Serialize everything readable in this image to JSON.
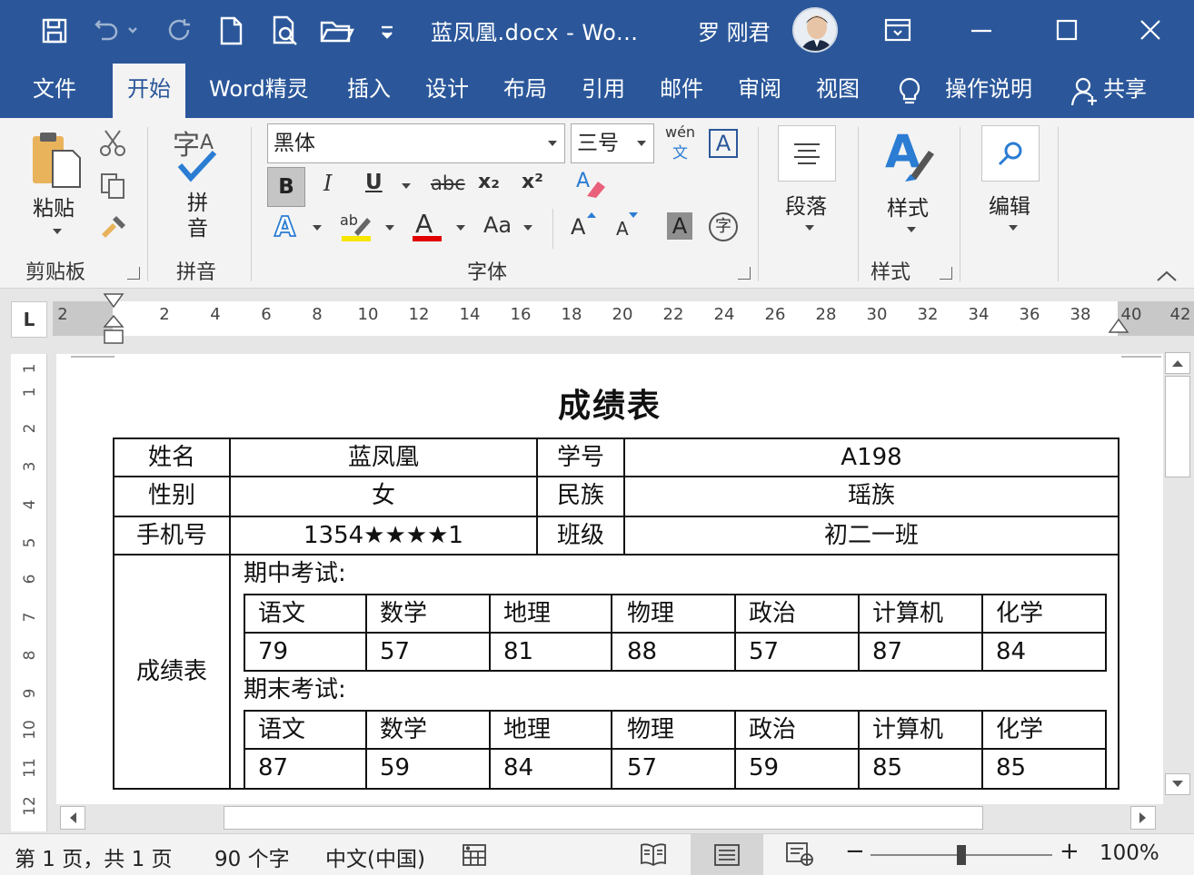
{
  "titlebar": {
    "doc_title": "蓝凤凰.docx  -  Wo...",
    "user_name": "罗 刚君",
    "icons": [
      "save-icon",
      "undo-icon",
      "redo-icon",
      "new-doc-icon",
      "print-preview-icon",
      "open-folder-icon",
      "customize-qat-icon"
    ]
  },
  "tabs": [
    "文件",
    "开始",
    "Word精灵",
    "插入",
    "设计",
    "布局",
    "引用",
    "邮件",
    "审阅",
    "视图"
  ],
  "tell_me": "操作说明",
  "share": "共享",
  "ribbon": {
    "paste": "粘贴",
    "clipboard_group": "剪贴板",
    "pinyin_btn": "拼\n音",
    "pinyin_group": "拼音",
    "font_name": "黑体",
    "font_size": "三号",
    "font_group": "字体",
    "bold": "B",
    "italic": "I",
    "underline": "U",
    "strike": "abc",
    "subscript": "x₂",
    "superscript": "x²",
    "change_case": "Aa",
    "grow_font": "A",
    "shrink_font": "A",
    "char_shading": "A",
    "enclose_char": "字",
    "wen": "wén",
    "wen_sub": "文",
    "char_border": "A",
    "paragraph": "段落",
    "styles": "样式",
    "styles_group": "样式",
    "editing": "编辑"
  },
  "ruler": {
    "corner": "L",
    "left_margin_label": "2",
    "numbers": [
      "2",
      "4",
      "6",
      "8",
      "10",
      "12",
      "14",
      "16",
      "18",
      "20",
      "22",
      "24",
      "26",
      "28",
      "30",
      "32",
      "34",
      "36",
      "38",
      "40",
      "42"
    ]
  },
  "vruler_numbers": [
    "1",
    "1",
    "2",
    "3",
    "4",
    "5",
    "6",
    "7",
    "8",
    "9",
    "10",
    "11",
    "12"
  ],
  "document": {
    "heading": "成绩表",
    "info": {
      "name_label": "姓名",
      "name_value": "蓝凤凰",
      "id_label": "学号",
      "id_value": "A198",
      "gender_label": "性别",
      "gender_value": "女",
      "ethnic_label": "民族",
      "ethnic_value": "瑶族",
      "phone_label": "手机号",
      "phone_value": "1354★★★★1",
      "class_label": "班级",
      "class_value": "初二一班"
    },
    "scores_label": "成绩表",
    "midterm": {
      "title": "期中考试:",
      "headers": [
        "语文",
        "数学",
        "地理",
        "物理",
        "政治",
        "计算机",
        "化学"
      ],
      "values": [
        "79",
        "57",
        "81",
        "88",
        "57",
        "87",
        "84"
      ]
    },
    "final": {
      "title": "期末考试:",
      "headers": [
        "语文",
        "数学",
        "地理",
        "物理",
        "政治",
        "计算机",
        "化学"
      ],
      "values": [
        "87",
        "59",
        "84",
        "57",
        "59",
        "85",
        "85"
      ]
    }
  },
  "statusbar": {
    "page": "第 1 页，共 1 页",
    "words": "90 个字",
    "language": "中文(中国)",
    "zoom": "100%",
    "zoom_minus": "−",
    "zoom_plus": "+"
  }
}
